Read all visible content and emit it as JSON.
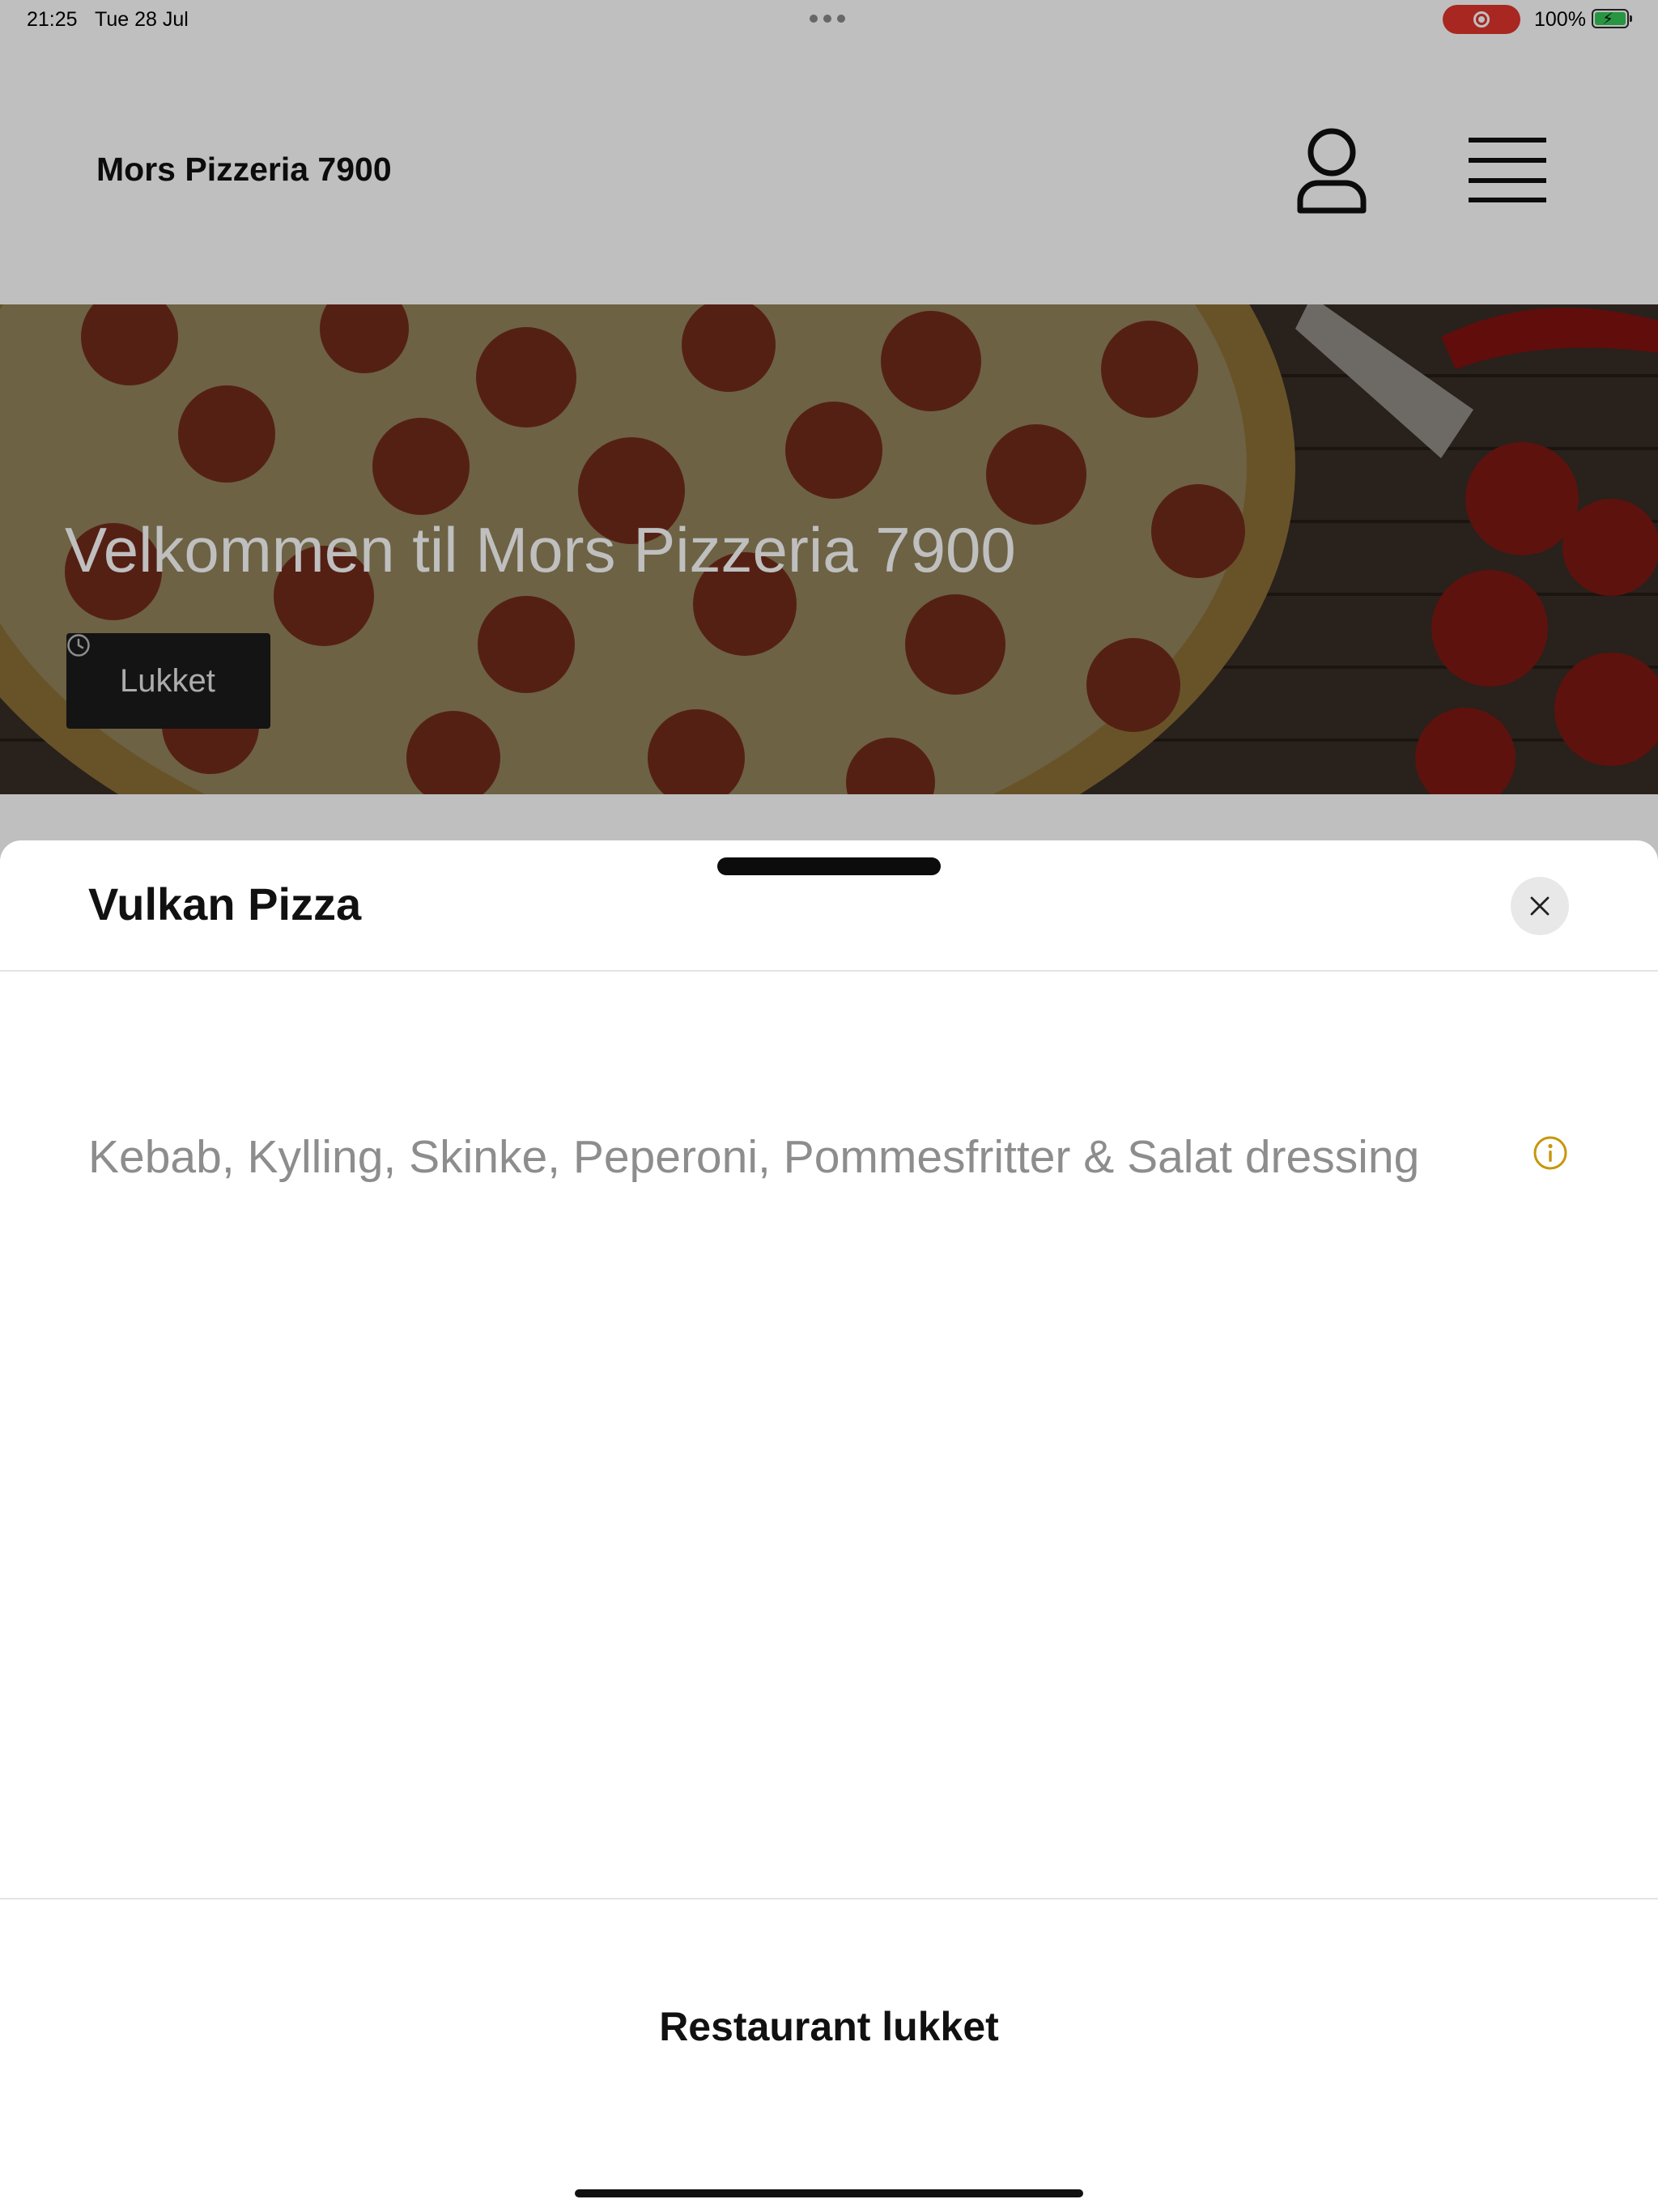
{
  "status_bar": {
    "time": "21:25",
    "date": "Tue 28 Jul",
    "battery_percent": "100%",
    "battery_level": 1.0,
    "screen_recording": true
  },
  "header": {
    "title": "Mors Pizzeria 7900",
    "profile_icon": "person-icon",
    "menu_icon": "hamburger-menu-icon"
  },
  "hero": {
    "title": "Velkommen til Mors Pizzeria 7900",
    "status_label": "Lukket",
    "status_icon": "clock-icon"
  },
  "sheet": {
    "title": "Vulkan Pizza",
    "close_icon": "close-icon",
    "description": "Kebab, Kylling, Skinke, Peperoni, Pommesfritter & Salat dressing",
    "info_icon": "info-icon",
    "footer_label": "Restaurant lukket"
  },
  "colors": {
    "accent": "#c8960c",
    "recording": "#e0362c",
    "battery": "#34c759"
  }
}
